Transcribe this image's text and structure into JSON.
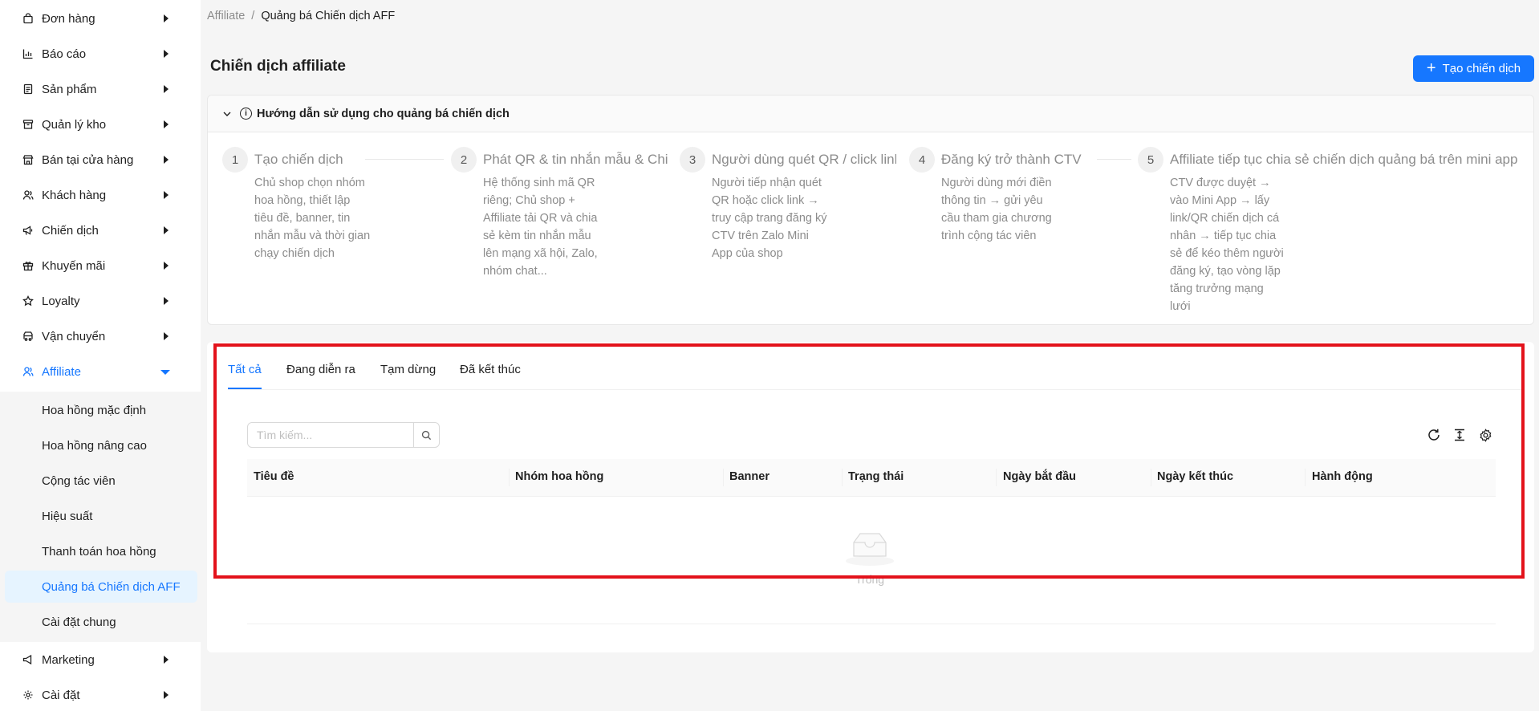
{
  "sidebar": {
    "items": [
      {
        "label": "Đơn hàng",
        "icon": "bag-icon"
      },
      {
        "label": "Báo cáo",
        "icon": "chart-icon"
      },
      {
        "label": "Sản phẩm",
        "icon": "product-icon"
      },
      {
        "label": "Quản lý kho",
        "icon": "warehouse-icon"
      },
      {
        "label": "Bán tại cửa hàng",
        "icon": "store-icon"
      },
      {
        "label": "Khách hàng",
        "icon": "users-icon"
      },
      {
        "label": "Chiến dịch",
        "icon": "megaphone-icon"
      },
      {
        "label": "Khuyến mãi",
        "icon": "gift-icon"
      },
      {
        "label": "Loyalty",
        "icon": "star-icon"
      },
      {
        "label": "Vận chuyển",
        "icon": "truck-icon"
      },
      {
        "label": "Affiliate",
        "icon": "affiliate-icon"
      },
      {
        "label": "Marketing",
        "icon": "marketing-icon"
      },
      {
        "label": "Cài đặt",
        "icon": "gear-icon"
      }
    ],
    "affiliate_submenu": [
      "Hoa hồng mặc định",
      "Hoa hồng nâng cao",
      "Cộng tác viên",
      "Hiệu suất",
      "Thanh toán hoa hồng",
      "Quảng bá Chiến dịch AFF",
      "Cài đặt chung"
    ]
  },
  "breadcrumb": {
    "root": "Affiliate",
    "separator": "/",
    "current": "Quảng bá Chiến dịch AFF"
  },
  "page": {
    "title": "Chiến dịch affiliate",
    "create_button": "Tạo chiến dịch"
  },
  "guide": {
    "title": "Hướng dẫn sử dụng cho quảng bá chiến dịch",
    "steps": [
      {
        "num": "1",
        "title": "Tạo chiến dịch",
        "desc": "Chủ shop chọn nhóm hoa hồng, thiết lập tiêu đề, banner, tin nhắn mẫu và thời gian chạy chiến dịch"
      },
      {
        "num": "2",
        "title": "Phát QR & tin nhắn mẫu & Chia",
        "desc": "Hệ thống sinh mã QR riêng; Chủ shop + Affiliate tải QR và chia sẻ kèm tin nhắn mẫu lên mạng xã hội, Zalo, nhóm chat..."
      },
      {
        "num": "3",
        "title": "Người dùng quét QR / click link",
        "desc": "Người tiếp nhận quét QR hoặc click link → truy cập trang đăng ký CTV trên Zalo Mini App của shop"
      },
      {
        "num": "4",
        "title": "Đăng ký trở thành CTV",
        "desc": "Người dùng mới điền thông tin → gửi yêu cầu tham gia chương trình cộng tác viên"
      },
      {
        "num": "5",
        "title": "Affiliate tiếp tục chia sẻ chiến dịch quảng bá trên mini app",
        "desc": "CTV được duyệt → vào Mini App → lấy link/QR chiến dịch cá nhân → tiếp tục chia sẻ để kéo thêm người đăng ký, tạo vòng lặp tăng trưởng mạng lưới"
      }
    ]
  },
  "tabs": [
    "Tất cả",
    "Đang diễn ra",
    "Tạm dừng",
    "Đã kết thúc"
  ],
  "search": {
    "placeholder": "Tìm kiếm..."
  },
  "table": {
    "columns": [
      "Tiêu đề",
      "Nhóm hoa hồng",
      "Banner",
      "Trạng thái",
      "Ngày bắt đầu",
      "Ngày kết thúc",
      "Hành động"
    ],
    "empty_text": "Trống"
  },
  "colors": {
    "accent": "#1677ff",
    "highlight": "#e3121b"
  }
}
